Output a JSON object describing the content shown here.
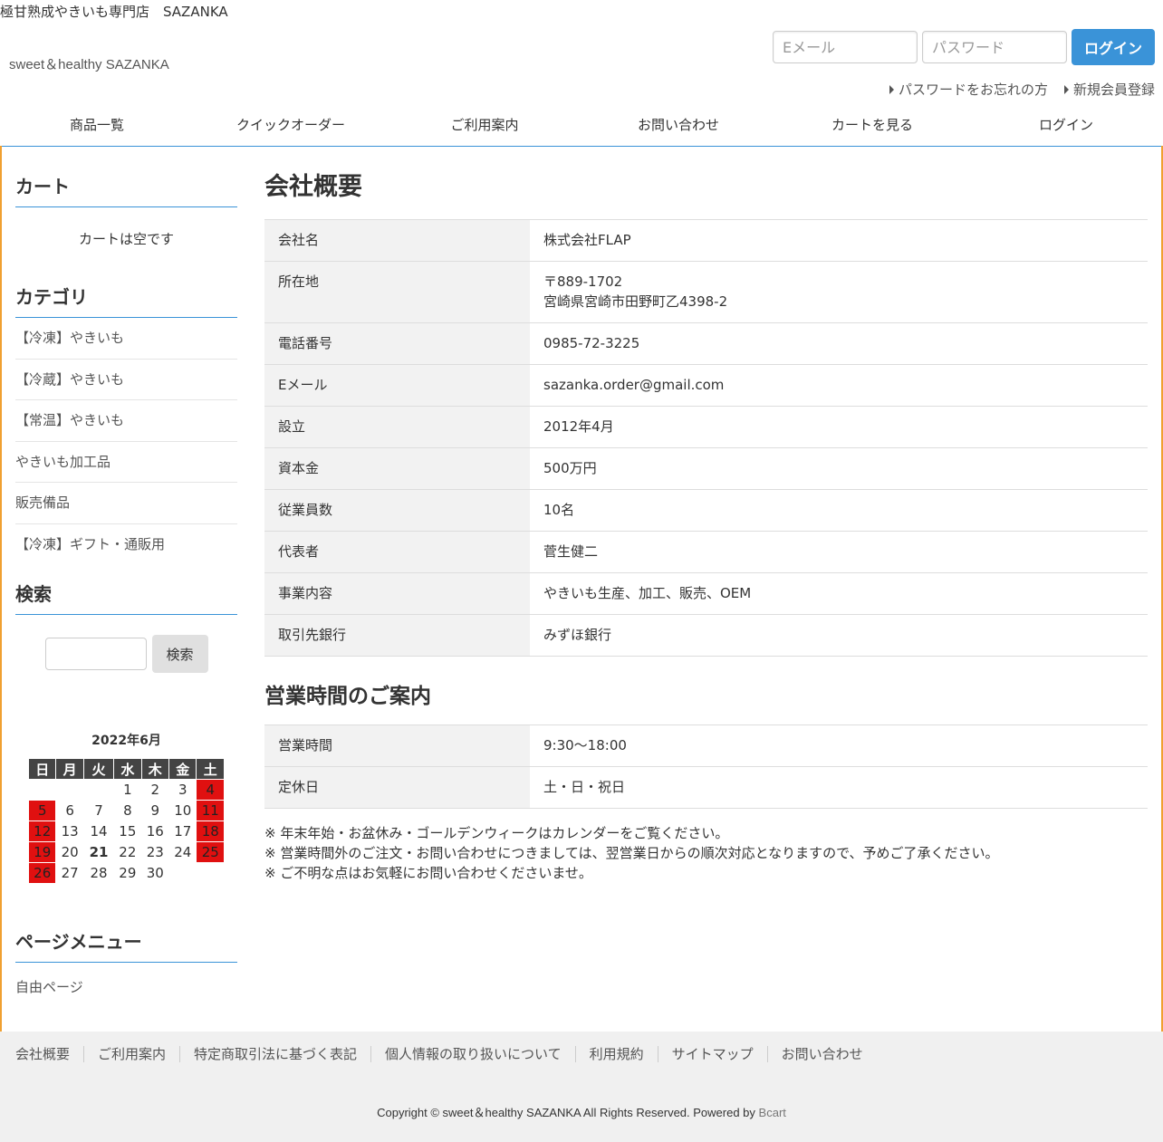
{
  "header": {
    "tagline": "極甘熟成やきいも専門店　SAZANKA",
    "shop_name": "sweet＆healthy SAZANKA",
    "email_placeholder": "Eメール",
    "password_placeholder": "パスワード",
    "login_button": "ログイン",
    "forgot_password": "パスワードをお忘れの方",
    "register": "新規会員登録"
  },
  "nav": [
    "商品一覧",
    "クイックオーダー",
    "ご利用案内",
    "お問い合わせ",
    "カートを見る",
    "ログイン"
  ],
  "sidebar": {
    "cart_title": "カート",
    "cart_empty": "カートは空です",
    "category_title": "カテゴリ",
    "categories": [
      "【冷凍】やきいも",
      "【冷蔵】やきいも",
      "【常温】やきいも",
      "やきいも加工品",
      "販売備品",
      "【冷凍】ギフト・通販用"
    ],
    "search_title": "検索",
    "search_button": "検索",
    "page_menu_title": "ページメニュー",
    "page_menu_item": "自由ページ"
  },
  "calendar": {
    "title": "2022年6月",
    "weekdays": [
      "日",
      "月",
      "火",
      "水",
      "木",
      "金",
      "土"
    ],
    "weeks": [
      [
        "",
        "",
        "",
        "1",
        "2",
        "3",
        "4"
      ],
      [
        "5",
        "6",
        "7",
        "8",
        "9",
        "10",
        "11"
      ],
      [
        "12",
        "13",
        "14",
        "15",
        "16",
        "17",
        "18"
      ],
      [
        "19",
        "20",
        "21",
        "22",
        "23",
        "24",
        "25"
      ],
      [
        "26",
        "27",
        "28",
        "29",
        "30",
        "",
        ""
      ]
    ],
    "holidays": [
      "4",
      "5",
      "11",
      "12",
      "18",
      "19",
      "25",
      "26"
    ],
    "today": "21",
    "holiday_color": "#e01010"
  },
  "main": {
    "title": "会社概要",
    "company": [
      {
        "label": "会社名",
        "value": "株式会社FLAP"
      },
      {
        "label": "所在地",
        "value": "〒889-1702\n宮崎県宮崎市田野町乙4398-2"
      },
      {
        "label": "電話番号",
        "value": "0985-72-3225"
      },
      {
        "label": "Eメール",
        "value": "sazanka.order@gmail.com"
      },
      {
        "label": "設立",
        "value": "2012年4月"
      },
      {
        "label": "資本金",
        "value": "500万円"
      },
      {
        "label": "従業員数",
        "value": "10名"
      },
      {
        "label": "代表者",
        "value": "菅生健二"
      },
      {
        "label": "事業内容",
        "value": "やきいも生産、加工、販売、OEM"
      },
      {
        "label": "取引先銀行",
        "value": "みずほ銀行"
      }
    ],
    "hours_title": "営業時間のご案内",
    "hours": [
      {
        "label": "営業時間",
        "value": "9:30～18:00"
      },
      {
        "label": "定休日",
        "value": "土・日・祝日"
      }
    ],
    "notes": [
      "※ 年末年始・お盆休み・ゴールデンウィークはカレンダーをご覧ください。",
      "※ 営業時間外のご注文・お問い合わせにつきましては、翌営業日からの順次対応となりますので、予めご了承ください。",
      "※ ご不明な点はお気軽にお問い合わせくださいませ。"
    ]
  },
  "footer": {
    "links": [
      "会社概要",
      "ご利用案内",
      "特定商取引法に基づく表記",
      "個人情報の取り扱いについて",
      "利用規約",
      "サイトマップ",
      "お問い合わせ"
    ],
    "copyright": "Copyright © sweet＆healthy SAZANKA All Rights Reserved. Powered by",
    "powered_by": "Bcart"
  },
  "colors": {
    "accent": "#3a93d8",
    "frame": "#f0a030"
  }
}
